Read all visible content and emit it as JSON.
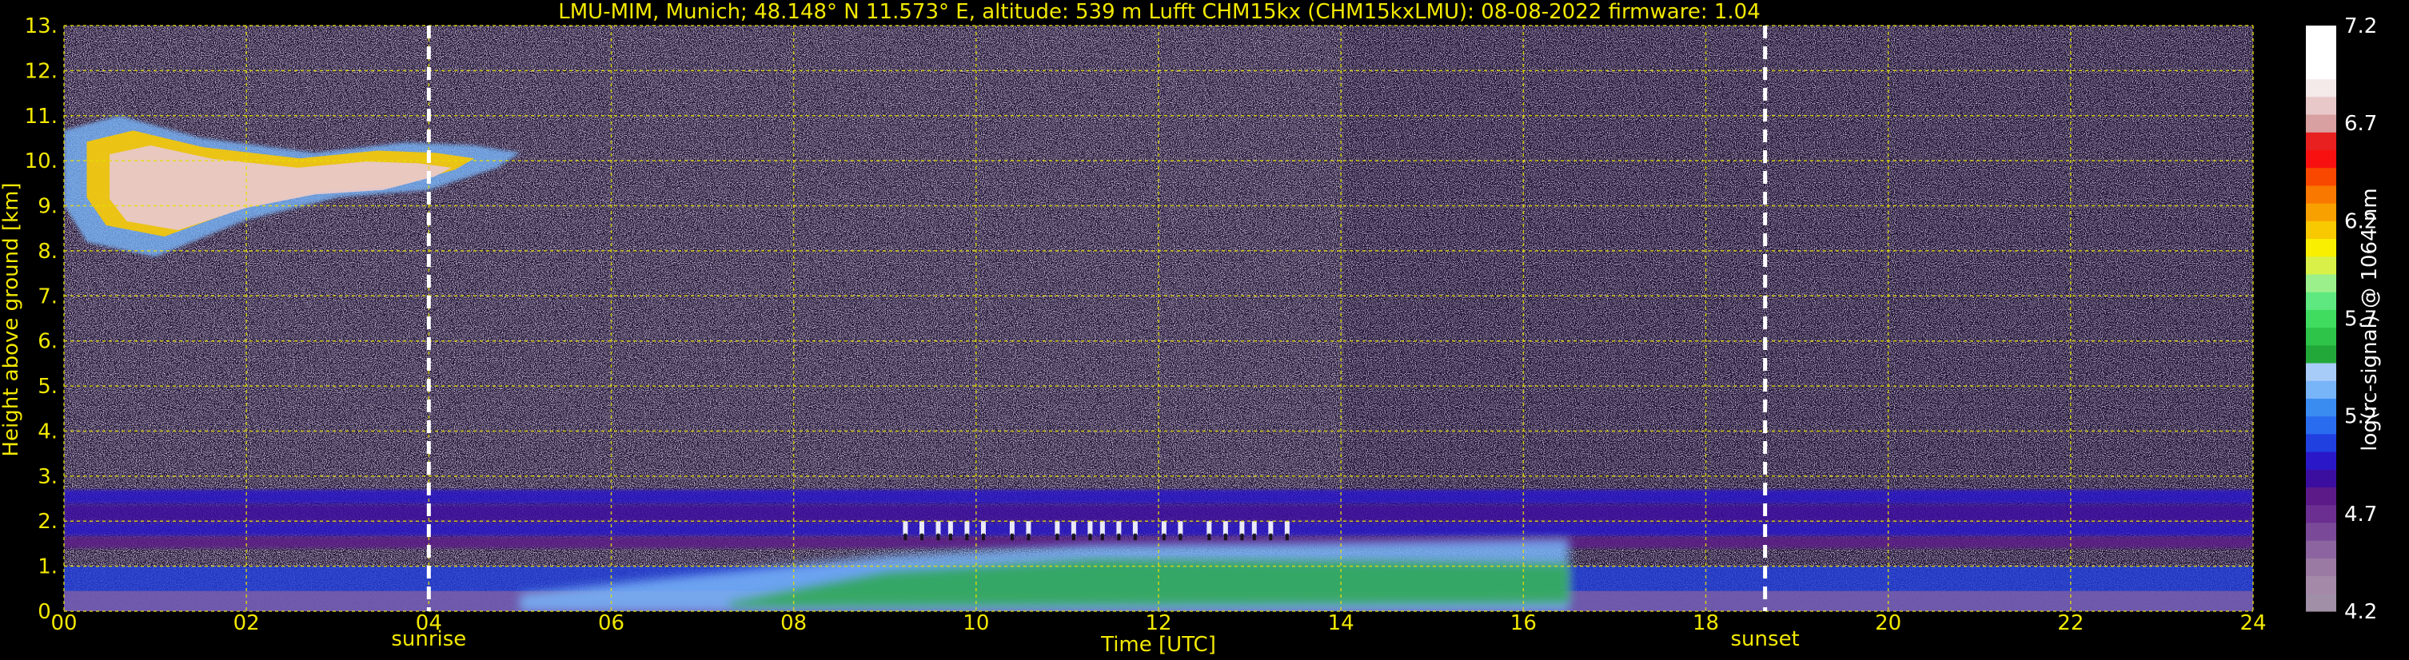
{
  "chart_data": {
    "type": "heatmap",
    "title": "LMU-MIM, Munich; 48.148° N 11.573° E, altitude: 539 m    Lufft CHM15kx (CHM15kxLMU): 08-08-2022    firmware: 1.04",
    "xlabel": "Time [UTC]",
    "ylabel": "Height above ground [km]",
    "xlim": [
      0,
      24
    ],
    "ylim": [
      0,
      13
    ],
    "x_ticks": [
      "00",
      "02",
      "04",
      "06",
      "08",
      "10",
      "12",
      "14",
      "16",
      "18",
      "20",
      "22",
      "24"
    ],
    "y_ticks": [
      "0.",
      "1.",
      "2.",
      "3.",
      "4.",
      "5.",
      "6.",
      "7.",
      "8.",
      "9.",
      "10.",
      "11.",
      "12.",
      "13."
    ],
    "grid": true,
    "events": [
      {
        "name": "sunrise",
        "time": 4.0
      },
      {
        "name": "sunset",
        "time": 18.65
      }
    ],
    "colorbar": {
      "label": "log(rc-signal) @ 1064 nm",
      "range": [
        4.2,
        7.2
      ],
      "ticks": [
        "4.2",
        "4.7",
        "5.2",
        "5.7",
        "6.2",
        "6.7",
        "7.2"
      ],
      "levels": [
        "#a08fa6",
        "#a48aa8",
        "#9a7aa3",
        "#8c64a0",
        "#7a4a98",
        "#6a2f90",
        "#5c1a88",
        "#3c0ea0",
        "#2a18c8",
        "#2040e0",
        "#2a6cf0",
        "#3a8cf0",
        "#78b4f8",
        "#a8ccf8",
        "#22a838",
        "#2ec44a",
        "#40dc60",
        "#60e880",
        "#9cf08c",
        "#d8f048",
        "#f8f000",
        "#f8c800",
        "#f8a000",
        "#f87800",
        "#f84800",
        "#f81010",
        "#e82020",
        "#d8a0a0",
        "#e8c8c8",
        "#f4eaea",
        "#ffffff",
        "#ffffff",
        "#ffffff"
      ]
    },
    "features": [
      {
        "name": "cirrus",
        "t0": 0.0,
        "t1": 5.0,
        "h_min": 7.7,
        "h_max": 11.0,
        "level": 6.8
      },
      {
        "name": "residual-layer",
        "t0": 0.0,
        "t1": 24.0,
        "h_min": 1.4,
        "h_max": 2.7,
        "level": 4.9
      },
      {
        "name": "boundary-layer",
        "t0": 5.0,
        "t1": 16.5,
        "h_min": 0.0,
        "h_max": 1.9,
        "level": 5.3
      },
      {
        "name": "cumulus-tops",
        "t0": 9.0,
        "t1": 13.5,
        "h_min": 1.5,
        "h_max": 2.0,
        "level": 7.0
      }
    ],
    "series": []
  }
}
